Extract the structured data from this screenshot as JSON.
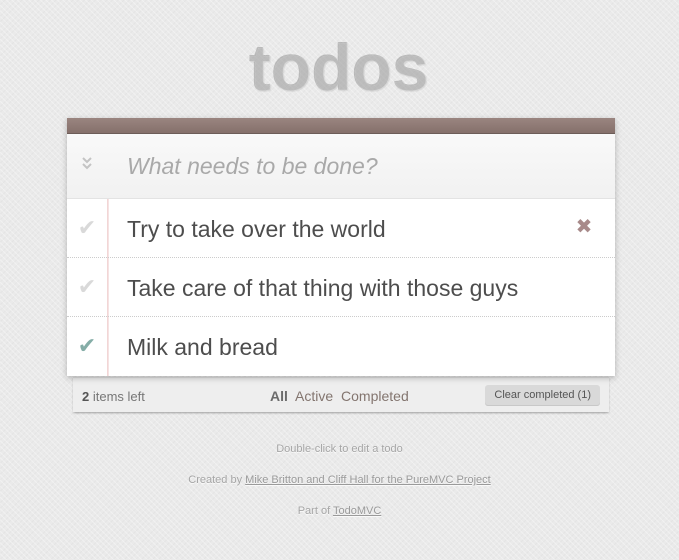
{
  "app": {
    "title": "todos"
  },
  "new_todo": {
    "placeholder": "What needs to be done?",
    "value": ""
  },
  "todos": [
    {
      "text": "Try to take over the world",
      "completed": false
    },
    {
      "text": "Take care of that thing with those guys",
      "completed": false
    },
    {
      "text": "Milk and bread",
      "completed": true
    }
  ],
  "footer": {
    "count": "2",
    "count_suffix": "items left",
    "filters": [
      "All",
      "Active",
      "Completed"
    ],
    "selected_filter": "All",
    "clear_completed": "Clear completed (1)"
  },
  "info": {
    "edit_hint": "Double-click to edit a todo",
    "created_prefix": "Created by",
    "created_link": "Mike Britton and Cliff Hall for the PureMVC Project",
    "part_prefix": "Part of",
    "part_link": "TodoMVC"
  },
  "icons": {
    "check": "check-icon",
    "destroy": "destroy-x-icon",
    "toggle_all": "double-chevron-down-icon"
  },
  "colors": {
    "header_bar": "#8d7874",
    "check_done": "#85ada7",
    "check_undone": "#d9d9d9",
    "destroy": "#a88a8a"
  }
}
